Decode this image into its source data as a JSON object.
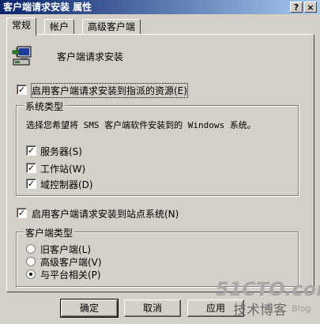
{
  "window": {
    "title": "客户端请求安装 属性",
    "help_button": "?",
    "close_button": "×"
  },
  "tabs": [
    {
      "label": "常规",
      "active": true
    },
    {
      "label": "帐户",
      "active": false
    },
    {
      "label": "高级客户端",
      "active": false
    }
  ],
  "header": {
    "title": "客户端请求安装"
  },
  "enable_assigned": {
    "label": "启用客户端请求安装到指派的资源(E)",
    "checked": true
  },
  "system_types": {
    "legend": "系统类型",
    "description": "选择您希望将 SMS 客户端软件安装到的 Windows 系统。",
    "items": [
      {
        "label": "服务器(S)",
        "checked": true
      },
      {
        "label": "工作站(W)",
        "checked": true
      },
      {
        "label": "域控制器(D)",
        "checked": true
      }
    ]
  },
  "enable_site": {
    "label": "启用客户端请求安装到站点系统(N)",
    "checked": true
  },
  "client_types": {
    "legend": "客户端类型",
    "items": [
      {
        "label": "旧客户端(L)",
        "selected": false
      },
      {
        "label": "高级客户端(V)",
        "selected": false
      },
      {
        "label": "与平台相关(P)",
        "selected": true
      }
    ]
  },
  "buttons": {
    "ok": "确定",
    "cancel": "取消",
    "apply": "应用"
  },
  "watermark": {
    "line1": "51CTO.com",
    "line2": "技术博客",
    "line3": "Blog"
  },
  "colors": {
    "dialog_bg": "#d4d0c8",
    "title_start": "#0a246a",
    "title_end": "#a6caf0",
    "watermark": "#a8a8a8"
  }
}
